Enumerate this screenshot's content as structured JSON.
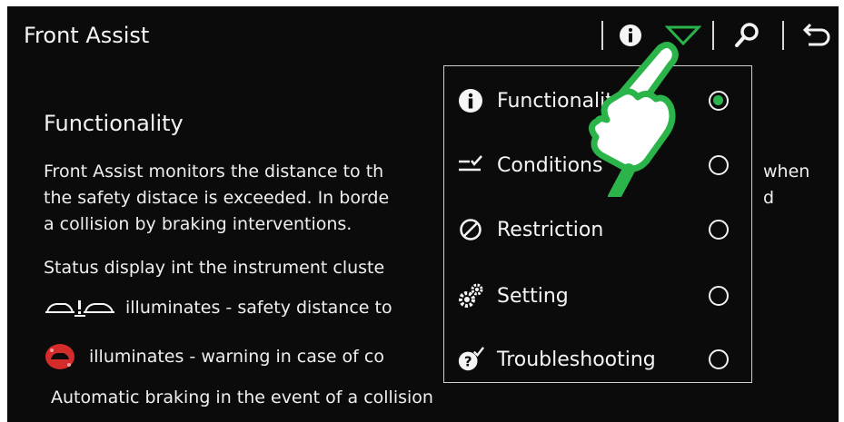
{
  "header": {
    "title": "Front Assist",
    "toolbar": {
      "info_icon": "info-icon",
      "menu_icon": "triangle-dropdown-icon",
      "search_icon": "search-icon",
      "back_icon": "back-arrow-icon"
    }
  },
  "content": {
    "heading": "Functionality",
    "paragraph_lines": [
      "Front Assist monitors the distance to th",
      "the safety distace is exceeded. In borde",
      "a collision by braking interventions."
    ],
    "paragraph_right_fragments": [
      "when",
      "d"
    ],
    "status_line": "Status display int the instrument cluste",
    "status_rows": [
      {
        "icon": "safety-distance-warning-icon",
        "text": "illuminates - safety distance to"
      },
      {
        "icon": "collision-warning-red-icon",
        "text": "illuminates - warning in case of co"
      }
    ],
    "footer_line": "Automatic braking in the event of a collision"
  },
  "menu": {
    "items": [
      {
        "label": "Functionality",
        "icon": "info-circle-icon",
        "selected": true
      },
      {
        "label": "Conditions",
        "icon": "conditions-check-icon",
        "selected": false
      },
      {
        "label": "Restriction",
        "icon": "prohibited-circle-icon",
        "selected": false
      },
      {
        "label": "Setting",
        "icon": "gears-icon",
        "selected": false
      },
      {
        "label": "Troubleshooting",
        "icon": "question-check-icon",
        "selected": false
      }
    ],
    "accent_color": "#2bb44a"
  },
  "overlay": {
    "icon": "pointing-hand-icon",
    "color": "#2bb44a"
  }
}
